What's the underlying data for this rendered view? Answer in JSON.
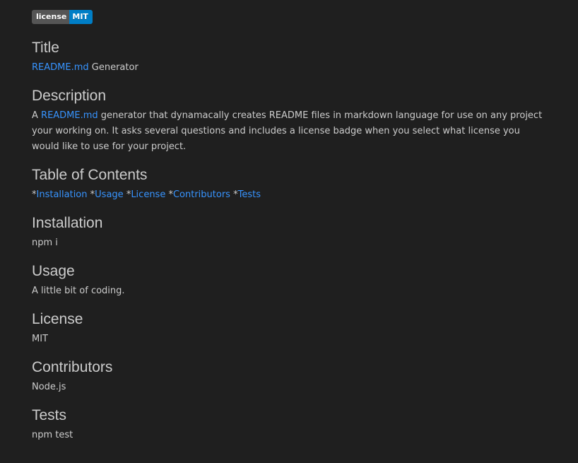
{
  "badge": {
    "label": "license",
    "value": "MIT",
    "value_color": "#007ec6"
  },
  "title": {
    "heading": "Title",
    "link": "README.md",
    "text": " Generator"
  },
  "description": {
    "heading": "Description",
    "prefix": "A ",
    "link": "README.md",
    "text": " generator that dynamacally creates README files in markdown language for use on any project your working on. It asks several questions and includes a license badge when you select what license you would like to use for your project."
  },
  "toc": {
    "heading": "Table of Contents",
    "bullet": "*",
    "items": [
      "Installation",
      "Usage",
      "License",
      "Contributors",
      "Tests"
    ]
  },
  "installation": {
    "heading": "Installation",
    "text": "npm i"
  },
  "usage": {
    "heading": "Usage",
    "text": "A little bit of coding."
  },
  "license": {
    "heading": "License",
    "text": "MIT"
  },
  "contributors": {
    "heading": "Contributors",
    "text": "Node.js"
  },
  "tests": {
    "heading": "Tests",
    "text": "npm test"
  },
  "colors": {
    "background": "#1f1f1f",
    "text": "#cccccc",
    "link": "#3794ff"
  }
}
